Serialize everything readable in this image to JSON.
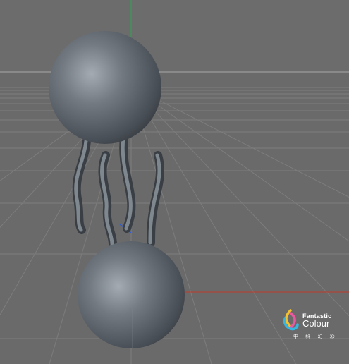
{
  "viewport": {
    "background": "#6a6a6a",
    "grid_color": "#7c7c7c",
    "horizon_color": "#9a9a9a",
    "axis_x_color": "#c0392b",
    "axis_y_color": "#27ae60",
    "axis_z_color": "#2e5cd6"
  },
  "model": {
    "surface_color": "#5d646b",
    "highlight_color": "#98a0a8",
    "shadow_color": "#2c3035"
  },
  "watermark": {
    "brand_line_1": "Fantastic",
    "brand_line_2": "Colour",
    "chinese": "中 科 幻 彩",
    "logo_colors": [
      "#f2c230",
      "#e85aa0",
      "#37b6e0"
    ]
  }
}
